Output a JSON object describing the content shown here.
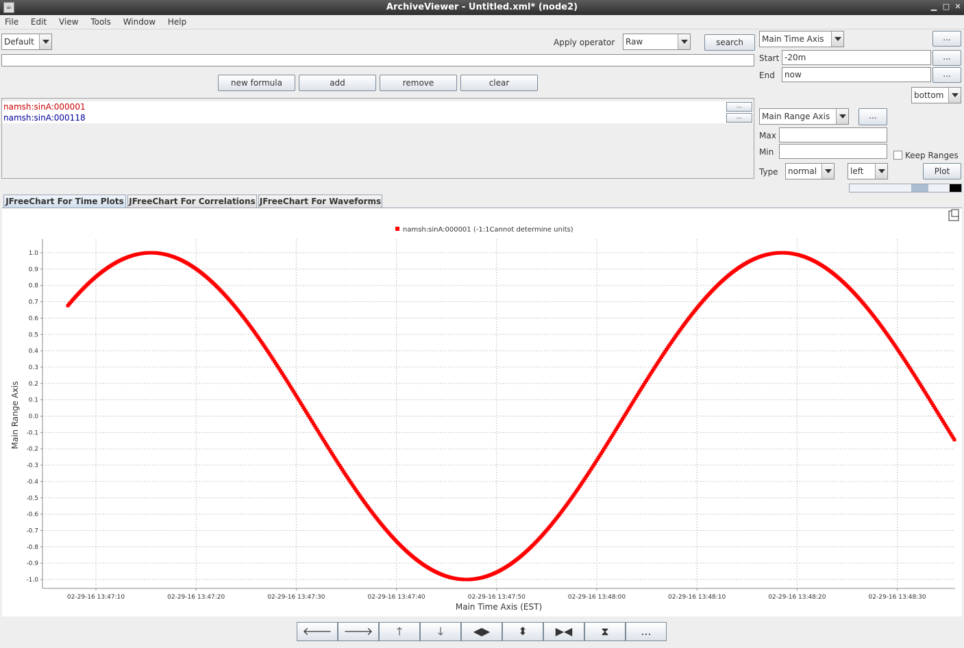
{
  "window": {
    "title": "ArchiveViewer - Untitled.xml* (node2)"
  },
  "menu": [
    "File",
    "Edit",
    "View",
    "Tools",
    "Window",
    "Help"
  ],
  "toolbar": {
    "profile": "Default",
    "apply_operator_label": "Apply operator",
    "operator": "Raw",
    "search_label": "search",
    "formula_value": "",
    "new_formula_label": "new formula",
    "add_label": "add",
    "remove_label": "remove",
    "clear_label": "clear"
  },
  "pvs": [
    {
      "name": "namsh:sinA:000001",
      "color": "#cc0000",
      "button": "..."
    },
    {
      "name": "namsh:sinA:000118",
      "color": "#000099",
      "button": "..."
    }
  ],
  "time_axis": {
    "selector": "Main Time Axis",
    "more": "...",
    "start_label": "Start",
    "start_value": "-20m",
    "end_label": "End",
    "end_value": "now",
    "position": "bottom"
  },
  "range_axis": {
    "selector": "Main Range Axis",
    "more": "...",
    "max_label": "Max",
    "max_value": "",
    "min_label": "Min",
    "min_value": "",
    "keep_ranges_label": "Keep Ranges",
    "keep_ranges_checked": false,
    "type_label": "Type",
    "type_value": "normal",
    "side_value": "left",
    "plot_label": "Plot"
  },
  "tabs": [
    "JFreeChart For Time Plots",
    "JFreeChart For Correlations",
    "JFreeChart For Waveforms"
  ],
  "active_tab": 0,
  "nav_buttons": [
    {
      "icon": "arrow-left-icon",
      "glyph": "🡐"
    },
    {
      "icon": "arrow-right-icon",
      "glyph": "🡒"
    },
    {
      "icon": "arrow-up-icon",
      "glyph": "🡑"
    },
    {
      "icon": "arrow-down-icon",
      "glyph": "🡓"
    },
    {
      "icon": "expand-horizontal-icon",
      "glyph": "◀▶"
    },
    {
      "icon": "expand-vertical-icon",
      "glyph": "⬍"
    },
    {
      "icon": "shrink-horizontal-icon",
      "glyph": "▶◀"
    },
    {
      "icon": "shrink-vertical-icon",
      "glyph": "⧗"
    },
    {
      "icon": "more-icon",
      "glyph": "..."
    }
  ],
  "chart_data": {
    "type": "scatter",
    "legend": "namsh:sinA:000001 (-1:1Cannot determine units)",
    "legend_placement": "top",
    "xlabel": "Main Time Axis (EST)",
    "ylabel": "Main Range Axis",
    "series_color": "#ff0000",
    "grid": true,
    "ylim": [
      -1.0,
      1.0
    ],
    "yticks": [
      "1.0",
      "0.9",
      "0.8",
      "0.7",
      "0.6",
      "0.5",
      "0.4",
      "0.3",
      "0.2",
      "0.1",
      "0.0",
      "-0.1",
      "-0.2",
      "-0.3",
      "-0.4",
      "-0.5",
      "-0.6",
      "-0.7",
      "-0.8",
      "-0.9",
      "-1.0"
    ],
    "xlim_seconds": [
      7.2,
      52.8
    ],
    "xtick_seconds": [
      10,
      20,
      30,
      40,
      50,
      60,
      70,
      80,
      90
    ],
    "xticks": [
      "02-29-16 13:47:10",
      "02-29-16 13:47:20",
      "02-29-16 13:47:30",
      "02-29-16 13:47:40",
      "02-29-16 13:47:50",
      "02-29-16 13:48:00",
      "02-29-16 13:48:10",
      "02-29-16 13:48:20",
      "02-29-16 13:48:30"
    ],
    "series": [
      {
        "name": "namsh:sinA:000001",
        "function": "sin",
        "period_seconds": 63,
        "peak_seconds": 15.5,
        "amplitude": 1.0,
        "start_seconds": 7.2,
        "end_seconds": 98.3,
        "sample_seconds": 0.125
      }
    ]
  }
}
